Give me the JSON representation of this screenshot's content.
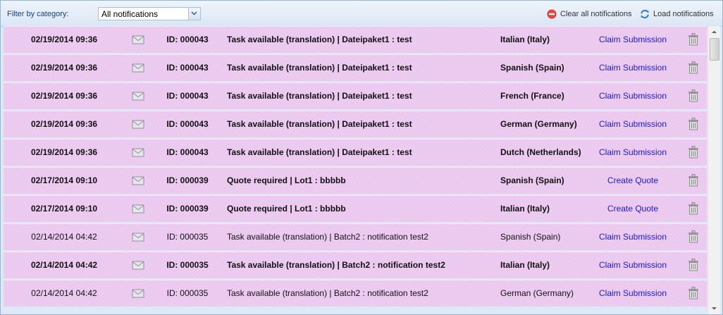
{
  "toolbar": {
    "filter_label": "Filter by category:",
    "filter_value": "All notifications",
    "clear_label": "Clear all notifications",
    "load_label": "Load notifications"
  },
  "colors": {
    "row_background": "#ebc8ef",
    "link": "#1a1ae6",
    "toolbar": "#dbe6f4"
  },
  "icons": {
    "row_status": "envelope-icon",
    "row_delete": "trash-icon",
    "clear": "stop-icon",
    "load": "refresh-icon",
    "dropdown": "chevron-down-icon"
  },
  "notifications": [
    {
      "date": "02/19/2014 09:36",
      "id": "ID: 000043",
      "message": "Task available (translation) | Dateipaket1 : test",
      "language": "Italian (Italy)",
      "action": "Claim Submission",
      "unread": true
    },
    {
      "date": "02/19/2014 09:36",
      "id": "ID: 000043",
      "message": "Task available (translation) | Dateipaket1 : test",
      "language": "Spanish (Spain)",
      "action": "Claim Submission",
      "unread": true
    },
    {
      "date": "02/19/2014 09:36",
      "id": "ID: 000043",
      "message": "Task available (translation) | Dateipaket1 : test",
      "language": "French (France)",
      "action": "Claim Submission",
      "unread": true
    },
    {
      "date": "02/19/2014 09:36",
      "id": "ID: 000043",
      "message": "Task available (translation) | Dateipaket1 : test",
      "language": "German (Germany)",
      "action": "Claim Submission",
      "unread": true
    },
    {
      "date": "02/19/2014 09:36",
      "id": "ID: 000043",
      "message": "Task available (translation) | Dateipaket1 : test",
      "language": "Dutch (Netherlands)",
      "action": "Claim Submission",
      "unread": true
    },
    {
      "date": "02/17/2014 09:10",
      "id": "ID: 000039",
      "message": "Quote required | Lot1 : bbbbb",
      "language": "Spanish (Spain)",
      "action": "Create Quote",
      "unread": true
    },
    {
      "date": "02/17/2014 09:10",
      "id": "ID: 000039",
      "message": "Quote required | Lot1 : bbbbb",
      "language": "Italian (Italy)",
      "action": "Create Quote",
      "unread": true
    },
    {
      "date": "02/14/2014 04:42",
      "id": "ID: 000035",
      "message": "Task available (translation) | Batch2 : notification test2",
      "language": "Spanish (Spain)",
      "action": "Claim Submission",
      "unread": false
    },
    {
      "date": "02/14/2014 04:42",
      "id": "ID: 000035",
      "message": "Task available (translation) | Batch2 : notification test2",
      "language": "Italian (Italy)",
      "action": "Claim Submission",
      "unread": true
    },
    {
      "date": "02/14/2014 04:42",
      "id": "ID: 000035",
      "message": "Task available (translation) | Batch2 : notification test2",
      "language": "German (Germany)",
      "action": "Claim Submission",
      "unread": false
    }
  ]
}
